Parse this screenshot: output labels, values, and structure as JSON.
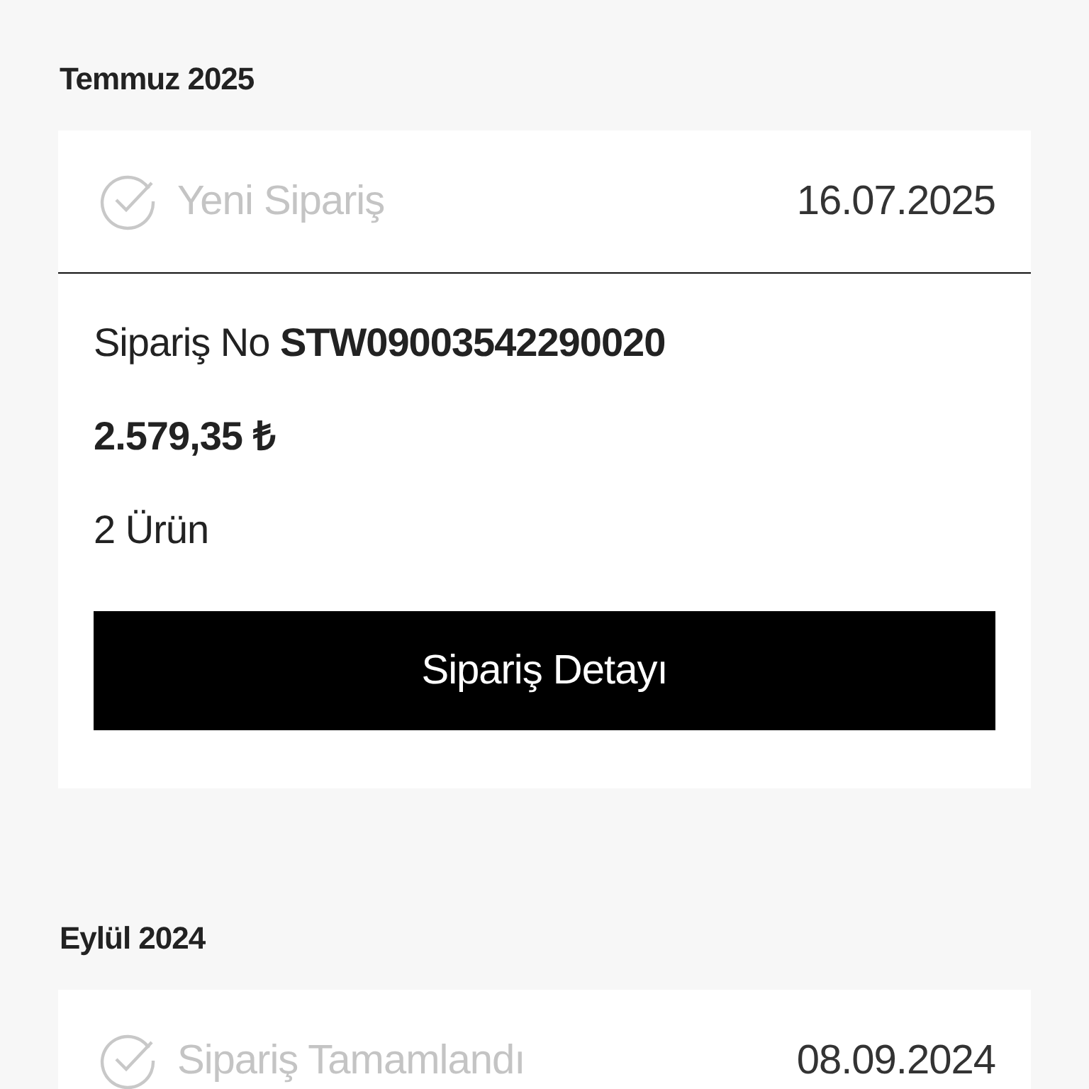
{
  "orders": [
    {
      "month": "Temmuz 2025",
      "status": "Yeni Sipariş",
      "date": "16.07.2025",
      "order_no_label": "Sipariş No",
      "order_no": "STW09003542290020",
      "total": "2.579,35 ₺",
      "items": "2 Ürün",
      "button": "Sipariş Detayı"
    },
    {
      "month": "Eylül 2024",
      "status": "Sipariş Tamamlandı",
      "date": "08.09.2024"
    }
  ]
}
